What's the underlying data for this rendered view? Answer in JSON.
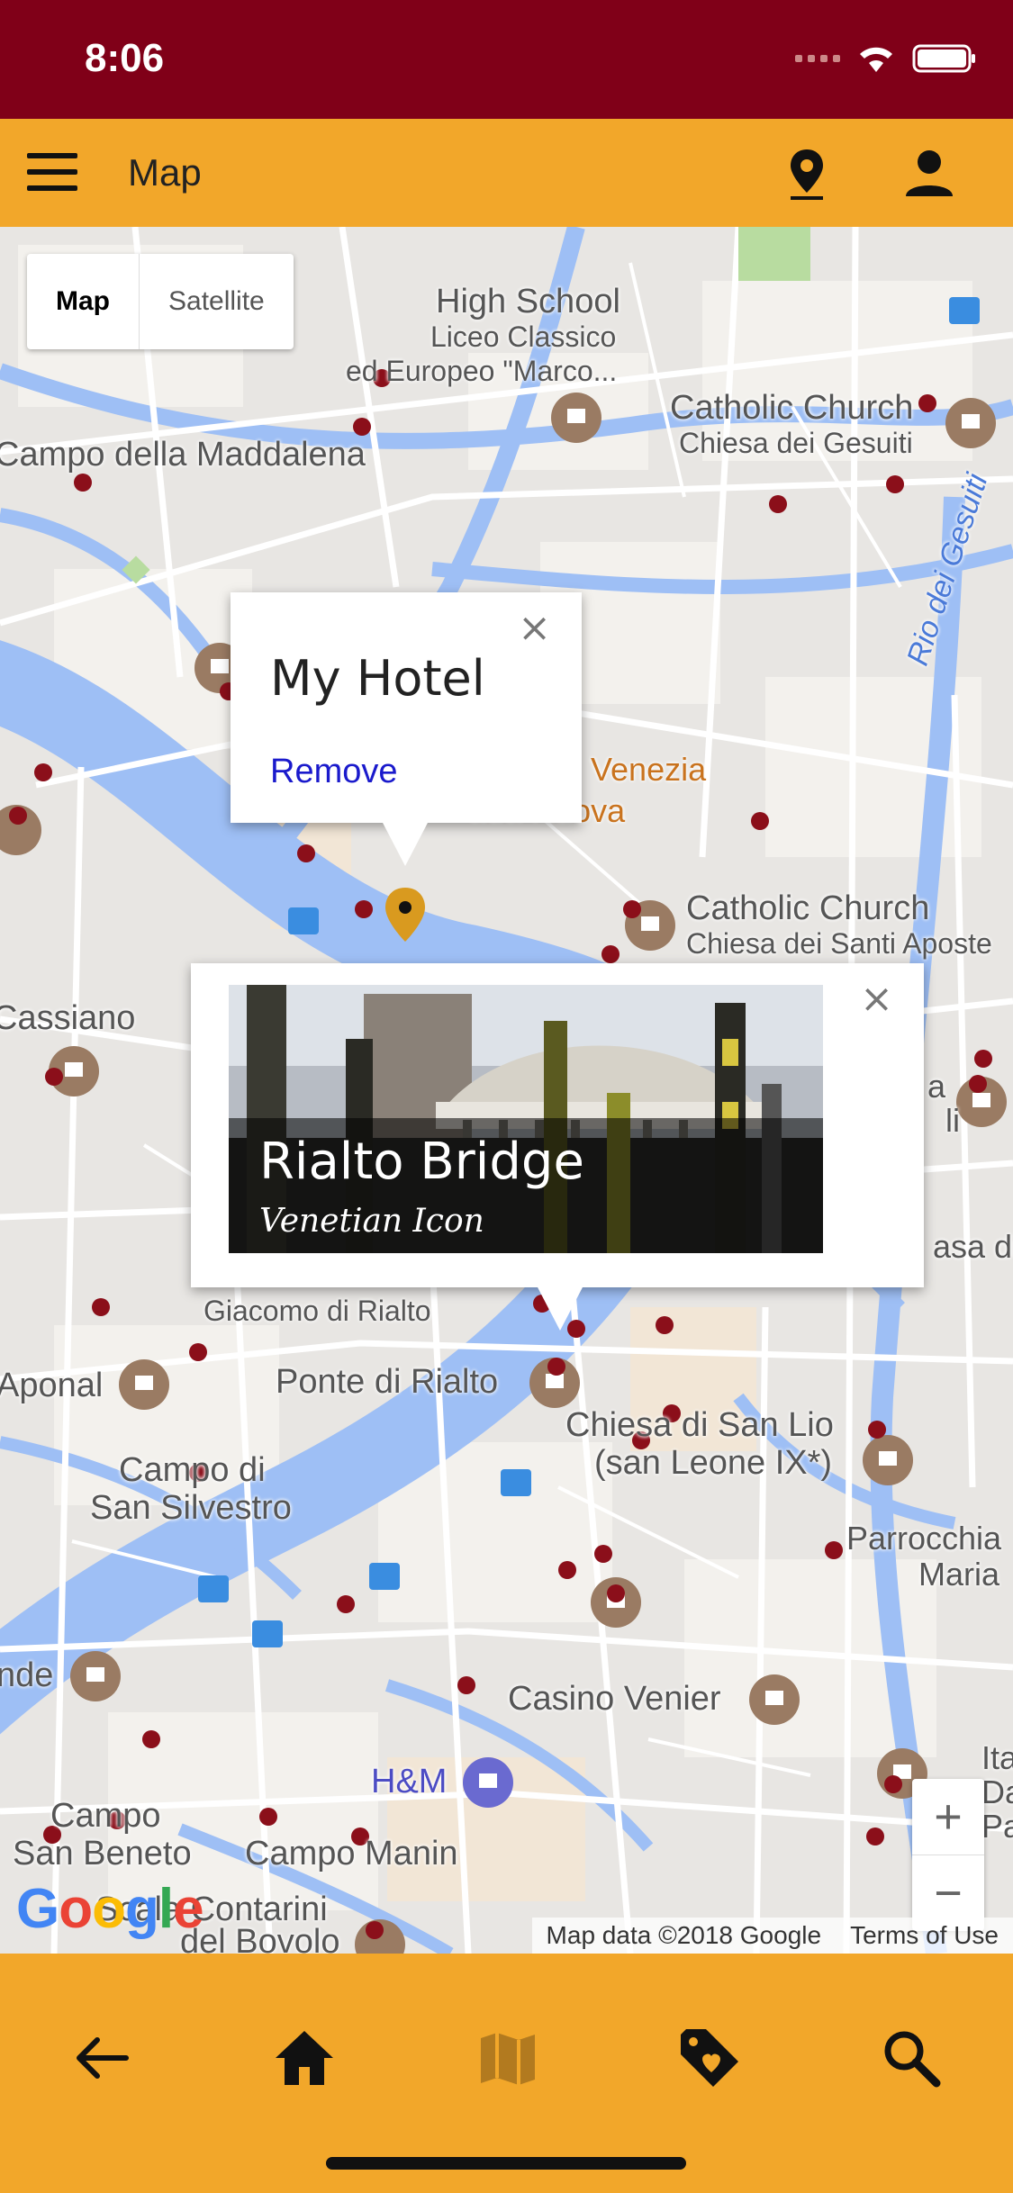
{
  "status": {
    "time": "8:06"
  },
  "app_bar": {
    "title": "Map"
  },
  "map_toggle": {
    "map": "Map",
    "satellite": "Satellite"
  },
  "map_labels": {
    "high_school_1": "High School",
    "high_school_2": "Liceo Classico",
    "high_school_3": "ed Europeo \"Marco...",
    "catholic_church_1": "Catholic Church",
    "catholic_church_1_sub": "Chiesa dei Gesuiti",
    "campo_maddalena": "Campo della Maddalena",
    "rio_gesuiti": "Rio dei Gesuiti",
    "venezia": "Venezia",
    "strada_nuova": "ada Nuova",
    "catholic_church_2": "Catholic Church",
    "catholic_church_2_sub": "Chiesa dei Santi Aposte",
    "cassiano": "Cassiano",
    "giacomo": "Giacomo di Rialto",
    "aponal": "Aponal",
    "ponte_rialto": "Ponte di Rialto",
    "san_lio_1": "Chiesa di San Lio",
    "san_lio_2": "(san Leone IX*)",
    "campo_di": "Campo di",
    "san_silvestro": "San Silvestro",
    "parrocchia_1": "Parrocchia",
    "parrocchia_2": "Maria",
    "nde": "nde",
    "casino_venier": "Casino Venier",
    "hm": "H&M",
    "campo_sb_1": "Campo",
    "campo_sb_2": "San Beneto",
    "campo_manin": "Campo Manin",
    "scala_1": "Scala Contarini",
    "scala_2": "del Bovolo",
    "right_a": "a",
    "right_li": "li",
    "right_asa": "asa di",
    "right_ita": "Ita",
    "right_da": "Da",
    "right_pa": "Pa"
  },
  "hotel_popup": {
    "title": "My Hotel",
    "remove": "Remove",
    "close": "×"
  },
  "bridge_popup": {
    "title": "Rialto Bridge",
    "subtitle": "Venetian Icon",
    "close": "×"
  },
  "zoom": {
    "in": "+",
    "out": "−"
  },
  "attribution": {
    "map_data": "Map data ©2018 Google",
    "terms": "Terms of Use"
  },
  "google_logo": "Google",
  "colors": {
    "status_bar": "#800018",
    "app_bar": "#f2a72a",
    "pin": "#8b0f1a",
    "water": "#9ebff5"
  }
}
